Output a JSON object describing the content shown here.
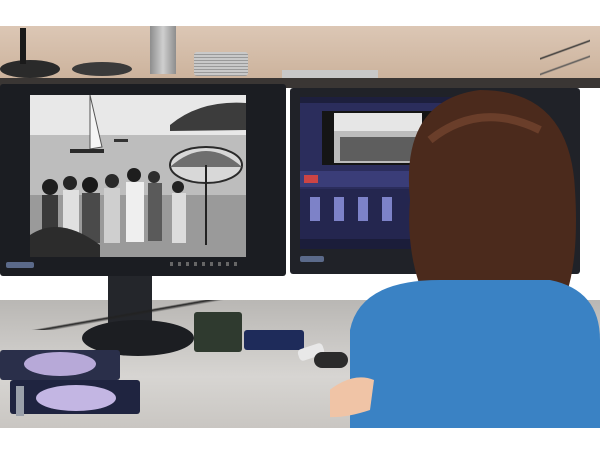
{
  "scene": {
    "description_colors": {
      "wall": "#d5bea9",
      "desk": "#c9c6c2",
      "monitor_bezel": "#1b1d22",
      "editor_ui": "#2a2c55",
      "shirt": "#3a82c4",
      "hair": "#4a2a1c"
    }
  }
}
